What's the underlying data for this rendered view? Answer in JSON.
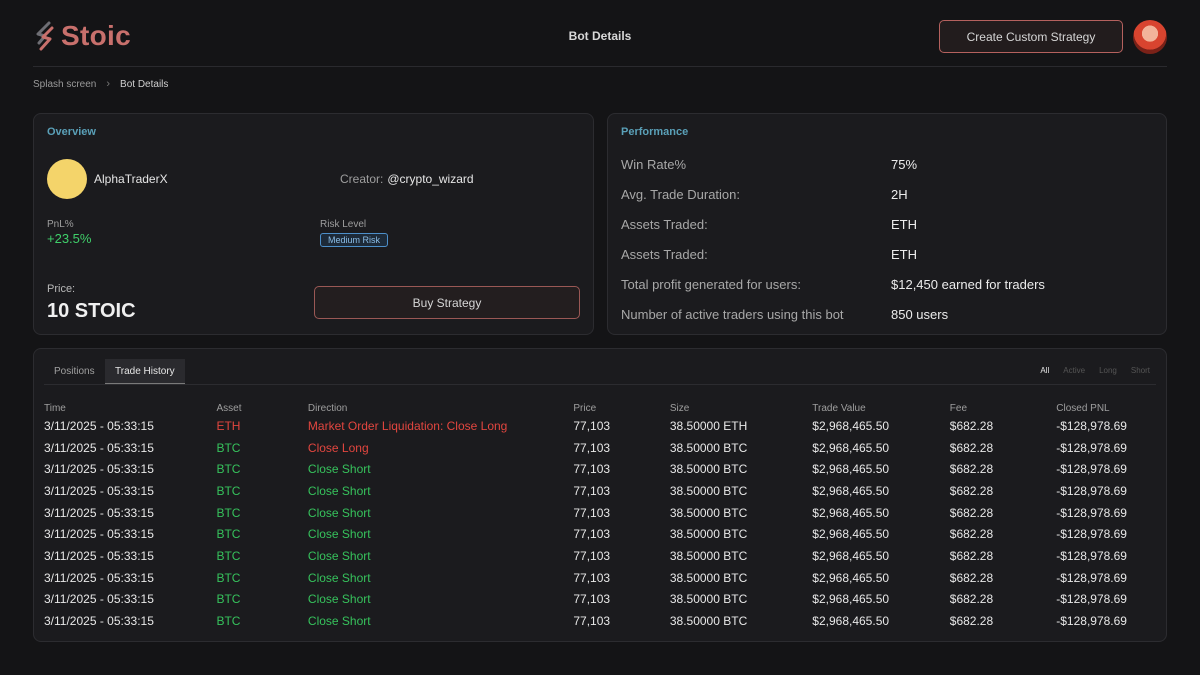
{
  "header": {
    "logo_text": "Stoic",
    "title": "Bot Details",
    "create_button": "Create Custom Strategy"
  },
  "breadcrumb": {
    "root": "Splash screen",
    "separator": "›",
    "current": "Bot Details"
  },
  "overview": {
    "title": "Overview",
    "bot_name": "AlphaTraderX",
    "creator_label": "Creator:",
    "creator_handle": "@crypto_wizard",
    "pnl_label": "PnL%",
    "pnl_value": "+23.5%",
    "risk_label": "Risk Level",
    "risk_value": "Medium Risk",
    "price_label": "Price:",
    "price_value": "10 STOIC",
    "buy_button": "Buy Strategy"
  },
  "performance": {
    "title": "Performance",
    "rows": [
      {
        "label": "Win Rate%",
        "value": "75%"
      },
      {
        "label": "Avg. Trade Duration:",
        "value": "2H"
      },
      {
        "label": "Assets Traded:",
        "value": "ETH"
      },
      {
        "label": "Assets Traded:",
        "value": "ETH"
      },
      {
        "label": "Total profit generated for users:",
        "value": "$12,450 earned for traders"
      },
      {
        "label": "Number of active traders using this bot",
        "value": "850 users"
      }
    ]
  },
  "trades": {
    "tabs": [
      "Positions",
      "Trade History"
    ],
    "active_tab": "Trade History",
    "filters": [
      "All",
      "Active",
      "Long",
      "Short"
    ],
    "active_filter": "All",
    "columns": [
      "Time",
      "Asset",
      "Direction",
      "Price",
      "Size",
      "Trade Value",
      "Fee",
      "Closed PNL"
    ],
    "rows": [
      {
        "time": "3/11/2025 - 05:33:15",
        "asset": "ETH",
        "direction": "Market Order Liquidation: Close Long",
        "price": "77,103",
        "size": "38.50000 ETH",
        "value": "$2,968,465.50",
        "fee": "$682.28",
        "pnl": "-$128,978.69",
        "tone": "red"
      },
      {
        "time": "3/11/2025 - 05:33:15",
        "asset": "BTC",
        "direction": "Close Long",
        "price": "77,103",
        "size": "38.50000 BTC",
        "value": "$2,968,465.50",
        "fee": "$682.28",
        "pnl": "-$128,978.69",
        "tone": "mixed"
      },
      {
        "time": "3/11/2025 - 05:33:15",
        "asset": "BTC",
        "direction": "Close Short",
        "price": "77,103",
        "size": "38.50000 BTC",
        "value": "$2,968,465.50",
        "fee": "$682.28",
        "pnl": "-$128,978.69",
        "tone": "green"
      },
      {
        "time": "3/11/2025 - 05:33:15",
        "asset": "BTC",
        "direction": "Close Short",
        "price": "77,103",
        "size": "38.50000 BTC",
        "value": "$2,968,465.50",
        "fee": "$682.28",
        "pnl": "-$128,978.69",
        "tone": "green"
      },
      {
        "time": "3/11/2025 - 05:33:15",
        "asset": "BTC",
        "direction": "Close Short",
        "price": "77,103",
        "size": "38.50000 BTC",
        "value": "$2,968,465.50",
        "fee": "$682.28",
        "pnl": "-$128,978.69",
        "tone": "green"
      },
      {
        "time": "3/11/2025 - 05:33:15",
        "asset": "BTC",
        "direction": "Close Short",
        "price": "77,103",
        "size": "38.50000 BTC",
        "value": "$2,968,465.50",
        "fee": "$682.28",
        "pnl": "-$128,978.69",
        "tone": "green"
      },
      {
        "time": "3/11/2025 - 05:33:15",
        "asset": "BTC",
        "direction": "Close Short",
        "price": "77,103",
        "size": "38.50000 BTC",
        "value": "$2,968,465.50",
        "fee": "$682.28",
        "pnl": "-$128,978.69",
        "tone": "green"
      },
      {
        "time": "3/11/2025 - 05:33:15",
        "asset": "BTC",
        "direction": "Close Short",
        "price": "77,103",
        "size": "38.50000 BTC",
        "value": "$2,968,465.50",
        "fee": "$682.28",
        "pnl": "-$128,978.69",
        "tone": "green"
      },
      {
        "time": "3/11/2025 - 05:33:15",
        "asset": "BTC",
        "direction": "Close Short",
        "price": "77,103",
        "size": "38.50000 BTC",
        "value": "$2,968,465.50",
        "fee": "$682.28",
        "pnl": "-$128,978.69",
        "tone": "green"
      },
      {
        "time": "3/11/2025 - 05:33:15",
        "asset": "BTC",
        "direction": "Close Short",
        "price": "77,103",
        "size": "38.50000 BTC",
        "value": "$2,968,465.50",
        "fee": "$682.28",
        "pnl": "-$128,978.69",
        "tone": "green"
      }
    ]
  },
  "colors": {
    "brand": "#c8706c",
    "accent_title": "#5aa0b8",
    "positive": "#36c25c",
    "negative": "#e2463f",
    "risk_badge": "#4d8fc9"
  }
}
